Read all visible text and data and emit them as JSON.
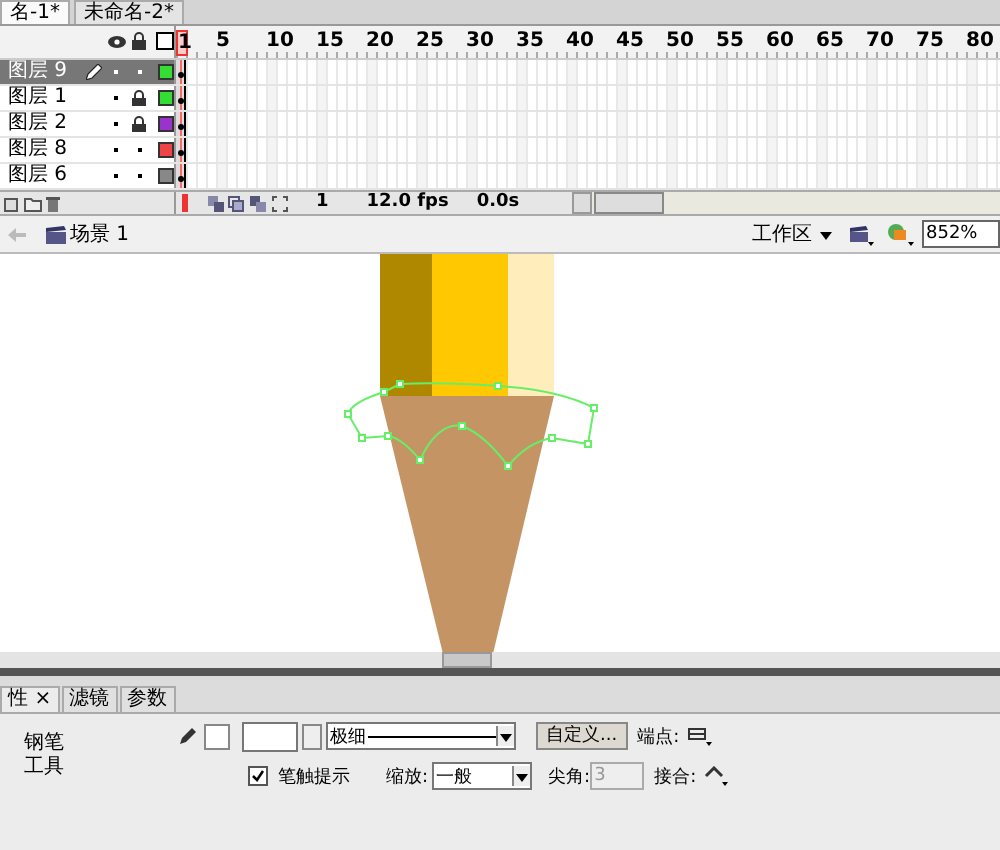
{
  "doc_tabs": [
    {
      "label": "名-1*",
      "selected": true
    },
    {
      "label": "未命名-2*",
      "selected": false
    }
  ],
  "timeline": {
    "frame_numbers": [
      "1",
      "5",
      "10",
      "15",
      "20",
      "25",
      "30",
      "35",
      "40",
      "45",
      "50",
      "55",
      "60",
      "65",
      "70",
      "75",
      "80"
    ],
    "layers": [
      {
        "name": "图层 9",
        "selected": true,
        "editing": true,
        "locked": false,
        "color": "#33dd33"
      },
      {
        "name": "图层 1",
        "selected": false,
        "editing": false,
        "locked": true,
        "color": "#33dd33"
      },
      {
        "name": "图层 2",
        "selected": false,
        "editing": false,
        "locked": true,
        "color": "#9933cc"
      },
      {
        "name": "图层 8",
        "selected": false,
        "editing": false,
        "locked": false,
        "color": "#ee4444"
      },
      {
        "name": "图层 6",
        "selected": false,
        "editing": false,
        "locked": false,
        "color": "#888888"
      }
    ],
    "current_frame": "1",
    "fps": "12.0 fps",
    "elapsed": "0.0s"
  },
  "scene_bar": {
    "scene": "场景 1",
    "workspace": "工作区",
    "zoom": "852%"
  },
  "properties": {
    "tabs": [
      {
        "label": "性",
        "selected": true,
        "close": "×"
      },
      {
        "label": "滤镜",
        "selected": false
      },
      {
        "label": "参数",
        "selected": false
      }
    ],
    "tool_name": "钢笔工具",
    "stroke_style": "极细",
    "custom_button": "自定义...",
    "cap_label": "端点:",
    "stroke_hinting": {
      "label": "笔触提示",
      "checked": true
    },
    "scale_label": "缩放:",
    "scale_value": "一般",
    "miter_label": "尖角:",
    "miter_value": "3",
    "join_label": "接合:"
  }
}
